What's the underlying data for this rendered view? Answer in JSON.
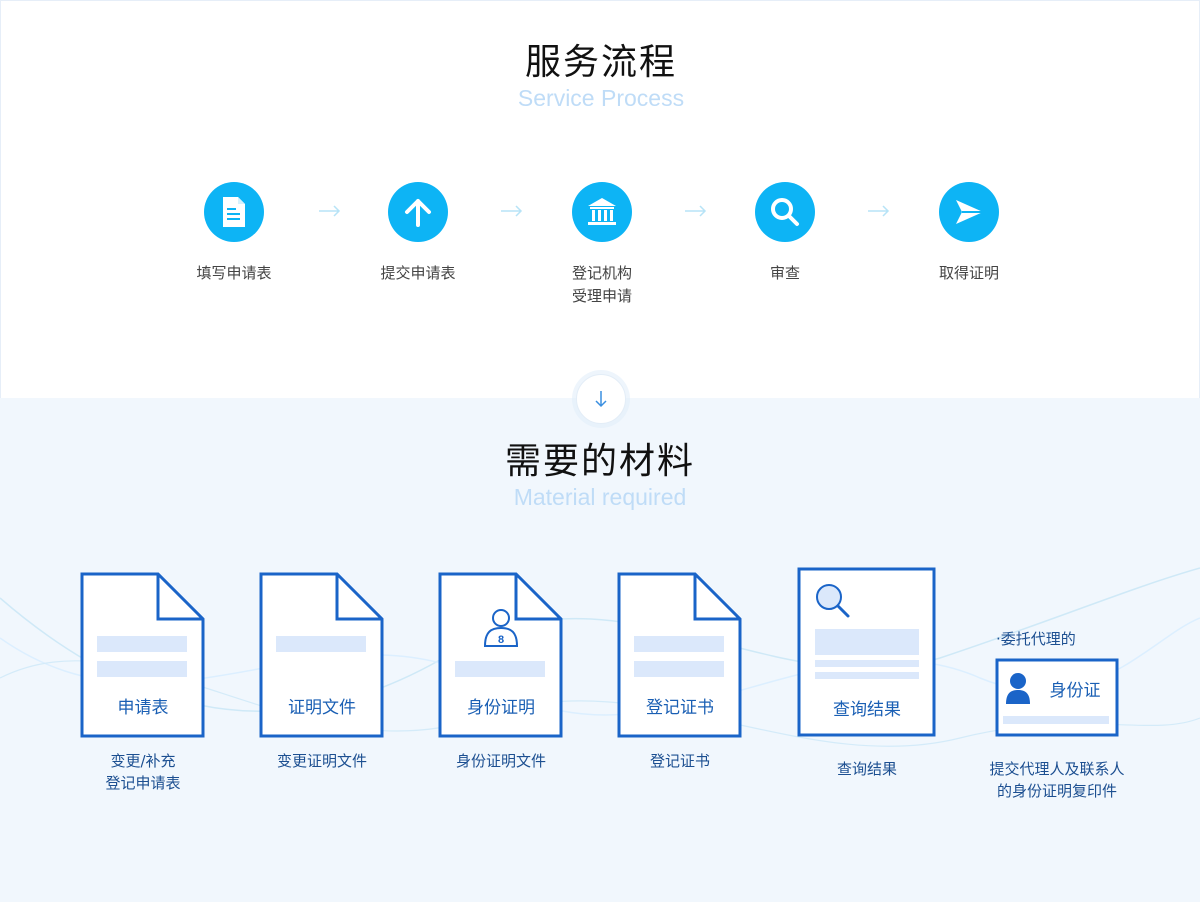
{
  "service": {
    "title": "服务流程",
    "subtitle": "Service Process",
    "steps": [
      {
        "label": "填写申请表",
        "icon": "document-icon"
      },
      {
        "label": "提交申请表",
        "icon": "upload-arrow-icon"
      },
      {
        "label": "登记机构\n受理申请",
        "icon": "bank-icon"
      },
      {
        "label": "审查",
        "icon": "magnifier-icon"
      },
      {
        "label": "取得证明",
        "icon": "send-icon"
      }
    ]
  },
  "materials": {
    "title": "需要的材料",
    "subtitle": "Material required",
    "items": [
      {
        "doc_label": "申请表",
        "caption": "变更/补充\n登记申请表"
      },
      {
        "doc_label": "证明文件",
        "caption": "变更证明文件"
      },
      {
        "doc_label": "身份证明",
        "caption": "身份证明文件"
      },
      {
        "doc_label": "登记证书",
        "caption": "登记证书"
      },
      {
        "doc_label": "查询结果",
        "caption": "查询结果"
      },
      {
        "doc_label": "身份证",
        "caption": "提交代理人及联系人\n的身份证明复印件"
      }
    ],
    "note": "·委托代理的"
  },
  "colors": {
    "accent": "#0db4f5",
    "doc_border": "#1a64c8",
    "placeholder_bar": "#dbe8fb",
    "bottom_bg": "#f1f7fd",
    "subtitle": "#bfdcf7"
  }
}
